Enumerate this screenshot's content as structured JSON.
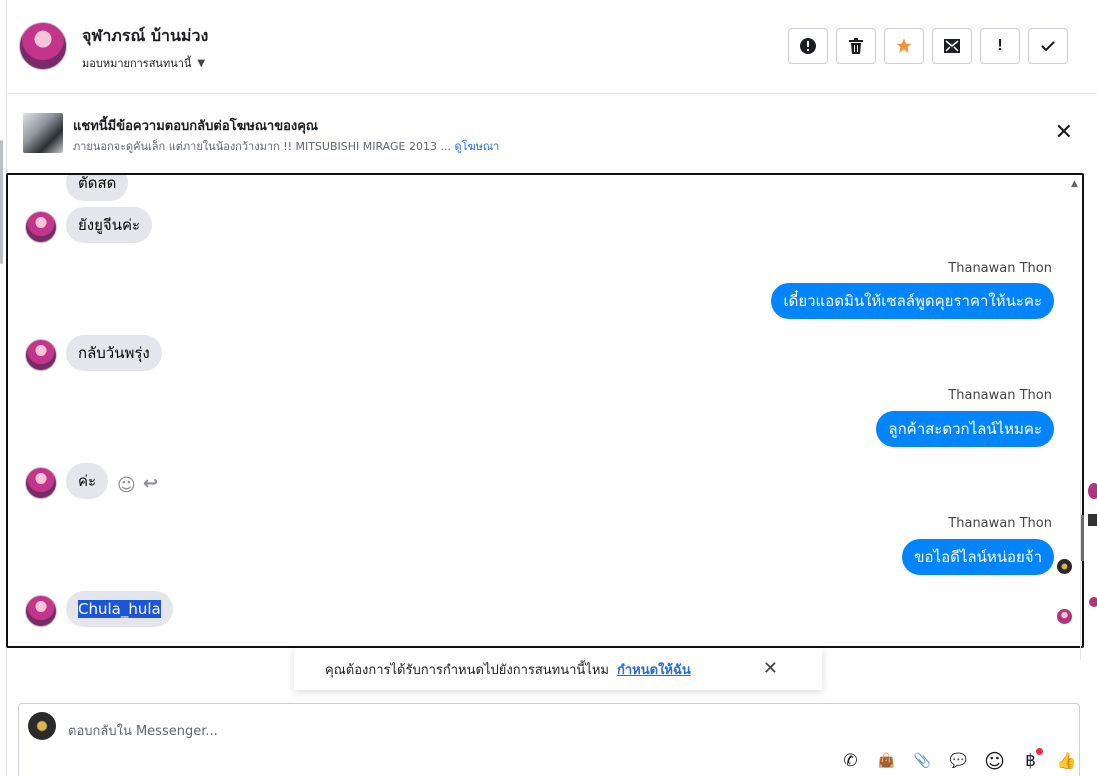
{
  "header": {
    "contact_name": "จุฬาภรณ์ บ้านม่วง",
    "assign_label": "มอบหมายการสนทนานี้",
    "toolbar": [
      {
        "name": "spam-button",
        "icon": "exclamation-circle-icon",
        "glyph": "❗"
      },
      {
        "name": "delete-button",
        "icon": "trash-icon",
        "glyph": "🗑"
      },
      {
        "name": "star-button",
        "icon": "star-icon",
        "glyph": "★"
      },
      {
        "name": "mark-unread-button",
        "icon": "envelope-icon",
        "glyph": "✉"
      },
      {
        "name": "follow-up-button",
        "icon": "exclamation-icon",
        "glyph": "!"
      },
      {
        "name": "done-button",
        "icon": "check-icon",
        "glyph": "✓"
      }
    ]
  },
  "ad_banner": {
    "title": "แชทนี้มีข้อความตอบกลับต่อโฆษณาของคุณ",
    "subtitle": "ภายนอกจะดูคันเล็ก แต่ภายในน้องกว้างมาก !! MITSUBISHI MIRAGE 2013 ...",
    "link": "ดูโฆษณา",
    "close_glyph": "✕"
  },
  "messages": [
    {
      "dir": "in",
      "text": "ตัดสด"
    },
    {
      "dir": "in",
      "text": "ยังยูจีนค่ะ"
    },
    {
      "dir": "out",
      "sender": "Thanawan Thon",
      "text": "เดี๋ยวแอดมินให้เซลล์พูดคุยราคาให้นะคะ"
    },
    {
      "dir": "in",
      "text": "กลับวันพรุ่ง"
    },
    {
      "dir": "out",
      "sender": "Thanawan Thon",
      "text": "ลูกค้าสะดวกไลน์ไหมคะ"
    },
    {
      "dir": "in",
      "text": "ค่ะ"
    },
    {
      "dir": "out",
      "sender": "Thanawan Thon",
      "text": "ขอไอดีไลน์หน่อยจ้า"
    },
    {
      "dir": "in",
      "text": "Chula_hula"
    }
  ],
  "hover_actions": {
    "react_glyph": "☺",
    "reply_glyph": "↩"
  },
  "suggestion": {
    "text": "คุณต้องการได้รับการกำหนดไปยังการสนทนานี้ไหม",
    "link": "กำหนดให้ฉัน",
    "close_glyph": "✕"
  },
  "composer": {
    "placeholder": "ตอบกลับใน Messenger...",
    "icons": [
      {
        "name": "call-add-icon",
        "glyph": "✆"
      },
      {
        "name": "shopping-bag-icon",
        "glyph": "👜"
      },
      {
        "name": "attachment-icon",
        "glyph": "📎"
      },
      {
        "name": "saved-reply-icon",
        "glyph": "💬"
      },
      {
        "name": "emoji-icon",
        "glyph": "☺"
      },
      {
        "name": "baht-payment-icon",
        "glyph": "฿"
      },
      {
        "name": "like-icon",
        "glyph": "👍"
      }
    ]
  },
  "colors": {
    "outgoing": "#0084ff",
    "incoming": "#e4e6eb",
    "link": "#216fdb",
    "star": "#f7923a"
  }
}
